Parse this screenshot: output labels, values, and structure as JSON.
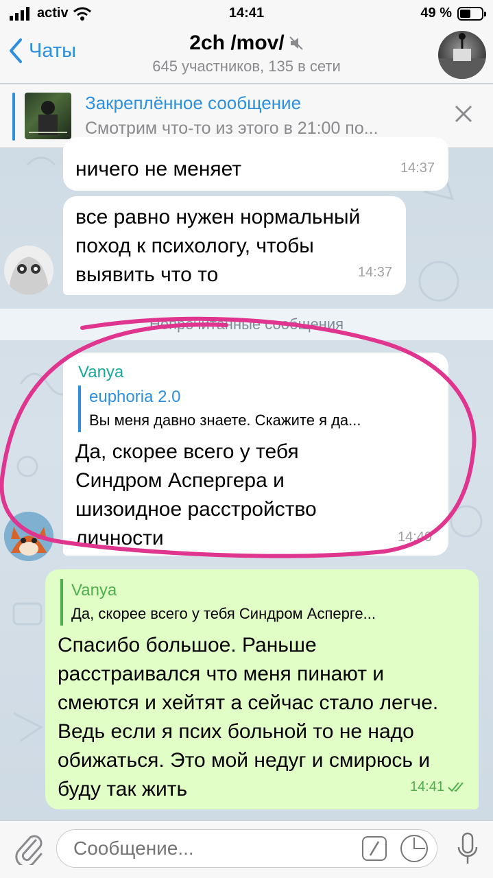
{
  "status_bar": {
    "carrier": "activ",
    "time": "14:41",
    "battery": "49 %"
  },
  "header": {
    "back_label": "Чаты",
    "title": "2ch /mov/",
    "subtitle": "645 участников, 135 в сети",
    "accent_color": "#2c8fe0"
  },
  "pinned": {
    "title": "Закреплённое сообщение",
    "text": "Смотрим что-то из этого в 21:00 по..."
  },
  "messages": [
    {
      "text": "ничего не меняет",
      "time": "14:37"
    },
    {
      "text": "все равно нужен нормальный поход к психологу, чтобы выявить что то",
      "time": "14:37"
    },
    {
      "sender": "Vanya",
      "reply_name": "euphoria 2.0",
      "reply_text": "Вы меня давно знаете. Скажите я да...",
      "text": "Да, скорее всего у тебя Синдром Аспергера и шизоидное расстройство личности",
      "time": "14:40"
    },
    {
      "reply_name": "Vanya",
      "reply_text": "Да, скорее всего у тебя Синдром Асперге...",
      "text": "Спасибо большое. Раньше расстраивался что меня пинают и смеются и хейтят а сейчас стало легче. Ведь если я псих больной то не надо обижаться. Это мой недуг и смирюсь и буду так жить",
      "time": "14:41"
    }
  ],
  "unread_label": "Непрочитанные сообщения",
  "input": {
    "placeholder": "Сообщение..."
  },
  "colors": {
    "outgoing_bubble": "#e1fec6",
    "annotation_circle": "#e0358f"
  }
}
